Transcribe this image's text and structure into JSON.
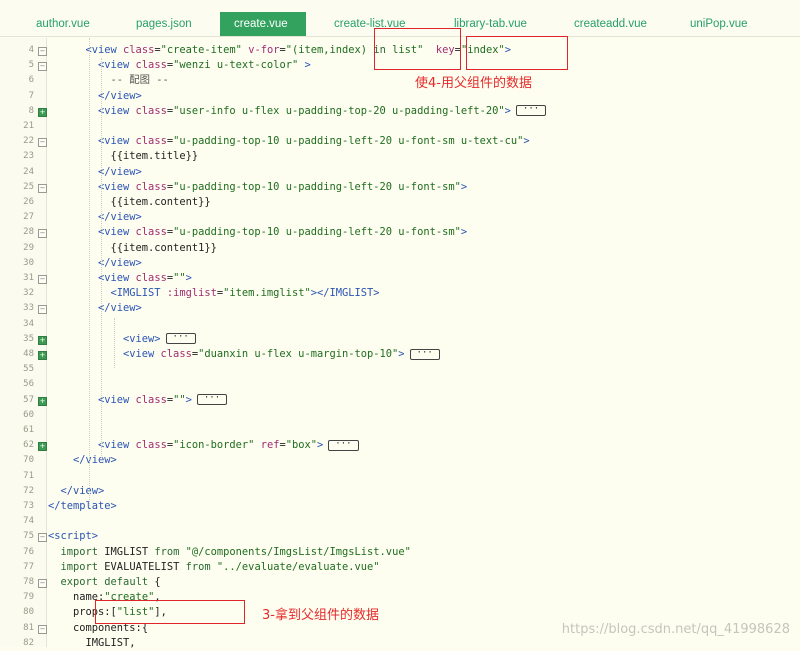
{
  "tabs": [
    "author.vue",
    "pages.json",
    "create.vue",
    "create-list.vue",
    "library-tab.vue",
    "createadd.vue",
    "uniPop.vue"
  ],
  "active_tab": "create.vue",
  "annotations": {
    "note_parent_data": "使4-用父组件的数据",
    "note_props": "3-拿到父组件的数据"
  },
  "watermark": "https://blog.csdn.net/qq_41998628",
  "code_lines": [
    {
      "num": "4",
      "fold": "minus",
      "indent": 6,
      "parts": [
        [
          "tg",
          "<view "
        ],
        [
          "at",
          "class"
        ],
        [
          "pl",
          "="
        ],
        [
          "st",
          "\"create-item\" "
        ],
        [
          "at",
          "v-for"
        ],
        [
          "pl",
          "="
        ],
        [
          "st",
          "\"(item,index) "
        ],
        [
          "kw",
          "in"
        ],
        [
          "st",
          " list\"  "
        ],
        [
          "at",
          "key"
        ],
        [
          "pl",
          "="
        ],
        [
          "st",
          "\"index\""
        ],
        [
          "tg",
          ">"
        ]
      ]
    },
    {
      "num": "5",
      "fold": "minus",
      "indent": 8,
      "parts": [
        [
          "tg",
          "<view "
        ],
        [
          "at",
          "class"
        ],
        [
          "pl",
          "="
        ],
        [
          "st",
          "\"wenzi u-text-color\" "
        ],
        [
          "tg",
          ">"
        ]
      ]
    },
    {
      "num": "6",
      "fold": "",
      "indent": 10,
      "parts": [
        [
          "cm",
          "-- 配图 --"
        ]
      ]
    },
    {
      "num": "7",
      "fold": "",
      "indent": 8,
      "parts": [
        [
          "tg",
          "</view>"
        ]
      ]
    },
    {
      "num": "8",
      "fold": "plus",
      "indent": 8,
      "ellipsis": true,
      "parts": [
        [
          "tg",
          "<view "
        ],
        [
          "at",
          "class"
        ],
        [
          "pl",
          "="
        ],
        [
          "st",
          "\"user-info u-flex u-padding-top-20 u-padding-left-20\""
        ],
        [
          "tg",
          ">"
        ]
      ]
    },
    {
      "num": "21",
      "fold": "",
      "indent": 0,
      "parts": []
    },
    {
      "num": "22",
      "fold": "minus",
      "indent": 8,
      "parts": [
        [
          "tg",
          "<view "
        ],
        [
          "at",
          "class"
        ],
        [
          "pl",
          "="
        ],
        [
          "st",
          "\"u-padding-top-10 u-padding-left-20 u-font-sm u-text-cu\""
        ],
        [
          "tg",
          ">"
        ]
      ]
    },
    {
      "num": "23",
      "fold": "",
      "indent": 10,
      "parts": [
        [
          "tx",
          "{{item.title}}"
        ]
      ]
    },
    {
      "num": "24",
      "fold": "",
      "indent": 8,
      "parts": [
        [
          "tg",
          "</view>"
        ]
      ]
    },
    {
      "num": "25",
      "fold": "minus",
      "indent": 8,
      "parts": [
        [
          "tg",
          "<view "
        ],
        [
          "at",
          "class"
        ],
        [
          "pl",
          "="
        ],
        [
          "st",
          "\"u-padding-top-10 u-padding-left-20 u-font-sm\""
        ],
        [
          "tg",
          ">"
        ]
      ]
    },
    {
      "num": "26",
      "fold": "",
      "indent": 10,
      "parts": [
        [
          "tx",
          "{{item.content}}"
        ]
      ]
    },
    {
      "num": "27",
      "fold": "",
      "indent": 8,
      "parts": [
        [
          "tg",
          "</view>"
        ]
      ]
    },
    {
      "num": "28",
      "fold": "minus",
      "indent": 8,
      "parts": [
        [
          "tg",
          "<view "
        ],
        [
          "at",
          "class"
        ],
        [
          "pl",
          "="
        ],
        [
          "st",
          "\"u-padding-top-10 u-padding-left-20 u-font-sm\""
        ],
        [
          "tg",
          ">"
        ]
      ]
    },
    {
      "num": "29",
      "fold": "",
      "indent": 10,
      "parts": [
        [
          "tx",
          "{{item.content1}}"
        ]
      ]
    },
    {
      "num": "30",
      "fold": "",
      "indent": 8,
      "parts": [
        [
          "tg",
          "</view>"
        ]
      ]
    },
    {
      "num": "31",
      "fold": "minus",
      "indent": 8,
      "parts": [
        [
          "tg",
          "<view "
        ],
        [
          "at",
          "class"
        ],
        [
          "pl",
          "="
        ],
        [
          "st",
          "\"\""
        ],
        [
          "tg",
          ">"
        ]
      ]
    },
    {
      "num": "32",
      "fold": "",
      "indent": 10,
      "parts": [
        [
          "tg",
          "<IMGLIST "
        ],
        [
          "at",
          ":imglist"
        ],
        [
          "pl",
          "="
        ],
        [
          "st",
          "\"item.imglist\""
        ],
        [
          "tg",
          "></IMGLIST>"
        ]
      ]
    },
    {
      "num": "33",
      "fold": "minus",
      "indent": 8,
      "parts": [
        [
          "tg",
          "</view>"
        ]
      ]
    },
    {
      "num": "34",
      "fold": "",
      "indent": 0,
      "parts": []
    },
    {
      "num": "35",
      "fold": "plus",
      "indent": 12,
      "ellipsis": true,
      "parts": [
        [
          "tg",
          "<view>"
        ]
      ]
    },
    {
      "num": "48",
      "fold": "plus",
      "indent": 12,
      "ellipsis": true,
      "parts": [
        [
          "tg",
          "<view "
        ],
        [
          "at",
          "class"
        ],
        [
          "pl",
          "="
        ],
        [
          "st",
          "\"duanxin u-flex u-margin-top-10\""
        ],
        [
          "tg",
          ">"
        ]
      ]
    },
    {
      "num": "55",
      "fold": "",
      "indent": 0,
      "parts": []
    },
    {
      "num": "56",
      "fold": "",
      "indent": 0,
      "parts": []
    },
    {
      "num": "57",
      "fold": "plus",
      "indent": 8,
      "ellipsis": true,
      "parts": [
        [
          "tg",
          "<view "
        ],
        [
          "at",
          "class"
        ],
        [
          "pl",
          "="
        ],
        [
          "st",
          "\"\""
        ],
        [
          "tg",
          ">"
        ]
      ]
    },
    {
      "num": "60",
      "fold": "",
      "indent": 0,
      "parts": []
    },
    {
      "num": "61",
      "fold": "",
      "indent": 0,
      "parts": []
    },
    {
      "num": "62",
      "fold": "plus",
      "indent": 8,
      "ellipsis": true,
      "parts": [
        [
          "tg",
          "<view "
        ],
        [
          "at",
          "class"
        ],
        [
          "pl",
          "="
        ],
        [
          "st",
          "\"icon-border\" "
        ],
        [
          "at",
          "ref"
        ],
        [
          "pl",
          "="
        ],
        [
          "st",
          "\"box\""
        ],
        [
          "tg",
          ">"
        ]
      ]
    },
    {
      "num": "70",
      "fold": "",
      "indent": 4,
      "parts": [
        [
          "tg",
          "</view>"
        ]
      ]
    },
    {
      "num": "71",
      "fold": "",
      "indent": 0,
      "parts": []
    },
    {
      "num": "72",
      "fold": "",
      "indent": 2,
      "parts": [
        [
          "tg",
          "</view>"
        ]
      ]
    },
    {
      "num": "73",
      "fold": "",
      "indent": 0,
      "parts": [
        [
          "tg",
          "</template>"
        ]
      ]
    },
    {
      "num": "74",
      "fold": "",
      "indent": 0,
      "parts": []
    },
    {
      "num": "75",
      "fold": "minus",
      "indent": 0,
      "parts": [
        [
          "tg",
          "<script>"
        ]
      ]
    },
    {
      "num": "76",
      "fold": "",
      "indent": 2,
      "parts": [
        [
          "kw",
          "import "
        ],
        [
          "tx",
          "IMGLIST "
        ],
        [
          "kw",
          "from "
        ],
        [
          "st",
          "\"@/components/ImgsList/ImgsList.vue\""
        ]
      ]
    },
    {
      "num": "77",
      "fold": "",
      "indent": 2,
      "parts": [
        [
          "kw",
          "import "
        ],
        [
          "tx",
          "EVALUATELIST "
        ],
        [
          "kw",
          "from "
        ],
        [
          "st",
          "\"../evaluate/evaluate.vue\""
        ]
      ]
    },
    {
      "num": "78",
      "fold": "minus",
      "indent": 2,
      "parts": [
        [
          "kw",
          "export default "
        ],
        [
          "tx",
          "{"
        ]
      ]
    },
    {
      "num": "79",
      "fold": "",
      "indent": 4,
      "parts": [
        [
          "tx",
          "name:"
        ],
        [
          "st",
          "\"create\""
        ],
        [
          "tx",
          ","
        ]
      ]
    },
    {
      "num": "80",
      "fold": "",
      "indent": 4,
      "parts": [
        [
          "tx",
          "props:["
        ],
        [
          "st",
          "\"list\""
        ],
        [
          "tx",
          "],"
        ]
      ]
    },
    {
      "num": "81",
      "fold": "minus",
      "indent": 4,
      "parts": [
        [
          "tx",
          "components:{"
        ]
      ]
    },
    {
      "num": "82",
      "fold": "",
      "indent": 6,
      "parts": [
        [
          "tx",
          "IMGLIST,"
        ]
      ]
    }
  ]
}
